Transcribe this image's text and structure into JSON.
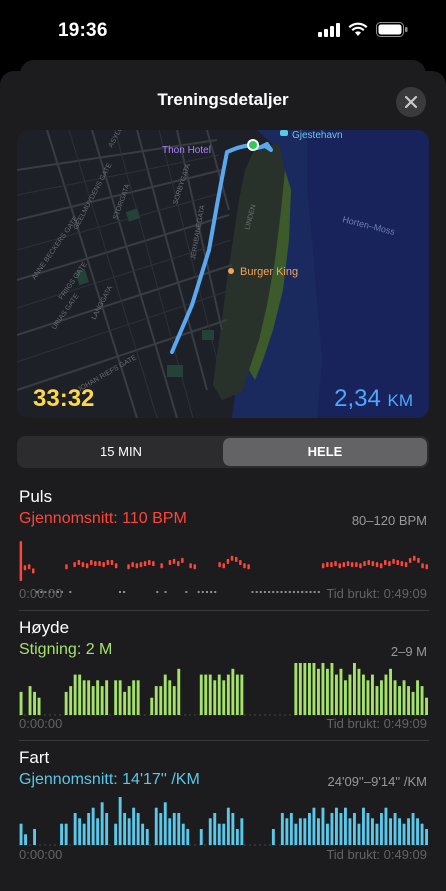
{
  "status": {
    "time": "19:36"
  },
  "header": {
    "title": "Treningsdetaljer"
  },
  "map": {
    "duration": "33:32",
    "distance_value": "2,34",
    "distance_unit": "KM",
    "labels": {
      "hotel": "Thon Hotel",
      "harbor": "Gjestehavn",
      "restaurant": "Burger King",
      "route": "Horten–Moss",
      "street_a": "ASYLGATA",
      "street_b": "GEELMUYDENS GATE",
      "street_c": "STORGATA",
      "street_d": "JERNBANEGATA",
      "street_e": "SORBYGATA",
      "street_f": "ANNE BECKERS GATE",
      "street_g": "FRIIGS GATE",
      "street_h": "URIAS GATE",
      "street_i": "LANGGATA",
      "street_j": "JOHAN RIEFS GATE",
      "street_k": "LINDEN"
    }
  },
  "segment": {
    "option_a": "15 MIN",
    "option_b": "HELE",
    "selected": "HELE"
  },
  "pulse": {
    "title": "Puls",
    "summary": "Gjennomsnitt: 110 BPM",
    "range": "80–120 BPM",
    "start": "0:00:00",
    "end": "Tid brukt: 0:49:09",
    "color": "#ff453a",
    "values": [
      118,
      95,
      96,
      92,
      0,
      0,
      0,
      0,
      0,
      0,
      0,
      96,
      0,
      98,
      100,
      98,
      97,
      100,
      99,
      99,
      98,
      100,
      100,
      97,
      0,
      0,
      96,
      98,
      97,
      98,
      99,
      100,
      99,
      0,
      97,
      0,
      100,
      101,
      99,
      102,
      0,
      97,
      96,
      0,
      0,
      0,
      0,
      0,
      98,
      97,
      101,
      104,
      103,
      100,
      97,
      96,
      0,
      0,
      0,
      0,
      0,
      0,
      0,
      0,
      0,
      0,
      0,
      0,
      0,
      0,
      0,
      0,
      0,
      97,
      98,
      98,
      99,
      97,
      98,
      99,
      98,
      98,
      97,
      99,
      100,
      99,
      98,
      97,
      100,
      99,
      101,
      100,
      99,
      98,
      102,
      104,
      102,
      97,
      96
    ]
  },
  "elevation": {
    "title": "Høyde",
    "summary": "Stigning: 2 M",
    "range": "2–9 M",
    "start": "0:00:00",
    "end": "Tid brukt: 0:49:09",
    "color": "#a4e26a",
    "values": [
      4,
      0,
      5,
      4,
      3,
      0,
      0,
      0,
      0,
      0,
      4,
      5,
      7,
      7,
      6,
      6,
      5,
      6,
      5,
      6,
      0,
      6,
      6,
      4,
      5,
      6,
      6,
      0,
      0,
      3,
      5,
      5,
      7,
      6,
      5,
      8,
      0,
      0,
      0,
      0,
      7,
      7,
      7,
      6,
      7,
      6,
      7,
      8,
      7,
      7,
      0,
      0,
      0,
      0,
      0,
      0,
      0,
      0,
      0,
      0,
      0,
      9,
      9,
      9,
      9,
      9,
      8,
      9,
      8,
      9,
      7,
      8,
      6,
      7,
      9,
      8,
      7,
      6,
      7,
      5,
      6,
      7,
      8,
      6,
      5,
      6,
      5,
      4,
      6,
      5,
      3
    ]
  },
  "speed": {
    "title": "Fart",
    "summary": "Gjennomsnitt: 14'17'' /KM",
    "range": "24'09''–9'14'' /KM",
    "start": "0:00:00",
    "end": "Tid brukt: 0:49:09",
    "color": "#5ac8e8",
    "values": [
      4,
      2,
      0,
      3,
      0,
      0,
      0,
      0,
      0,
      4,
      4,
      0,
      6,
      5,
      4,
      6,
      7,
      5,
      8,
      6,
      0,
      4,
      9,
      6,
      5,
      7,
      6,
      4,
      3,
      0,
      7,
      6,
      8,
      5,
      6,
      6,
      4,
      3,
      0,
      0,
      3,
      0,
      5,
      6,
      4,
      4,
      7,
      6,
      3,
      5,
      0,
      0,
      0,
      0,
      0,
      0,
      3,
      0,
      6,
      5,
      6,
      4,
      5,
      5,
      6,
      7,
      5,
      7,
      4,
      6,
      7,
      6,
      7,
      5,
      6,
      4,
      7,
      6,
      5,
      4,
      6,
      7,
      5,
      6,
      5,
      4,
      5,
      6,
      5,
      4,
      3
    ]
  }
}
